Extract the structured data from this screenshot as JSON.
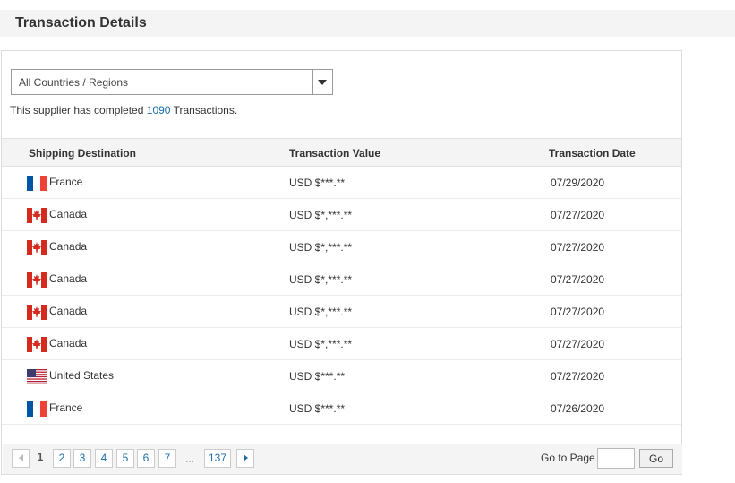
{
  "header": {
    "title": "Transaction Details"
  },
  "filter": {
    "selected": "All Countries / Regions",
    "icon": "chevron-down-icon"
  },
  "summary": {
    "prefix": "This supplier has completed",
    "count": "1090",
    "suffix": "Transactions."
  },
  "table": {
    "columns": [
      "Shipping Destination",
      "Transaction Value",
      "Transaction Date"
    ],
    "rows": [
      {
        "country": "France",
        "flag": "france-flag-icon",
        "value": "USD $***.**",
        "date": "07/29/2020"
      },
      {
        "country": "Canada",
        "flag": "canada-flag-icon",
        "value": "USD $*,***.**",
        "date": "07/27/2020"
      },
      {
        "country": "Canada",
        "flag": "canada-flag-icon",
        "value": "USD $*,***.**",
        "date": "07/27/2020"
      },
      {
        "country": "Canada",
        "flag": "canada-flag-icon",
        "value": "USD $*,***.**",
        "date": "07/27/2020"
      },
      {
        "country": "Canada",
        "flag": "canada-flag-icon",
        "value": "USD $*,***.**",
        "date": "07/27/2020"
      },
      {
        "country": "Canada",
        "flag": "canada-flag-icon",
        "value": "USD $*,***.**",
        "date": "07/27/2020"
      },
      {
        "country": "United States",
        "flag": "united-states-flag-icon",
        "value": "USD $***.**",
        "date": "07/27/2020"
      },
      {
        "country": "France",
        "flag": "france-flag-icon",
        "value": "USD $***.**",
        "date": "07/26/2020"
      }
    ]
  },
  "pagination": {
    "current": "1",
    "pages": [
      "2",
      "3",
      "4",
      "5",
      "6",
      "7"
    ],
    "ellipsis": "...",
    "last": "137",
    "goto_label": "Go to Page",
    "goto_value": "",
    "go_button": "Go"
  },
  "colors": {
    "link": "#1a6ea8",
    "header_bg": "#f4f4f4",
    "flag_red": "#d52b1e",
    "flag_blue": "#0055a4"
  }
}
